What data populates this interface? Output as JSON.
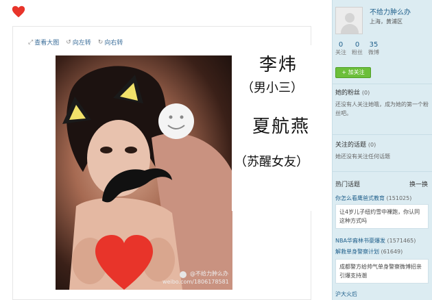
{
  "toolbar": {
    "view_large": "查看大图",
    "rotate_left": "向左转",
    "rotate_right": "向右转"
  },
  "photo": {
    "watermark_user": "@不给力肿么办",
    "watermark_url": "weibo.com/1806178581"
  },
  "caption": {
    "name1": "李炜",
    "role1": "（男小三）",
    "name2": "夏航燕",
    "role2": "（苏醒女友）"
  },
  "profile": {
    "username": "不给力肿么办",
    "location": "上海，黄浦区",
    "stats": [
      {
        "num": "0",
        "label": "关注"
      },
      {
        "num": "0",
        "label": "粉丝"
      },
      {
        "num": "35",
        "label": "微博"
      }
    ],
    "follow_button": "+ 加关注"
  },
  "fans": {
    "title": "她的粉丝",
    "count": "(0)",
    "text": "还没有人关注她哦，成为她的第一个粉丝吧。"
  },
  "topics_followed": {
    "title": "关注的话题",
    "count": "(0)",
    "text": "她还没有关注任何话题"
  },
  "hot_topics": {
    "title": "热门话题",
    "refresh": "换一换",
    "items": [
      {
        "label": "你怎么看鹰爸式教育",
        "count": "(151025)",
        "card": "让4岁儿子纽约雪中裸跑，你认同这种方式吗"
      },
      {
        "label": "NBA华裔林书豪爆发",
        "count": "(1571465)",
        "card": ""
      },
      {
        "label": "解救单身警察计划",
        "count": "(61649)",
        "card": "成都警方给帅气单身警察微博招亲引爆支持潮"
      },
      {
        "label": "沪大火后",
        "count": "",
        "card": ""
      }
    ]
  },
  "colors": {
    "sidebar_bg": "#dcecf2",
    "link": "#1f5f8b",
    "follow_btn": "#6cbf3a",
    "heart": "#e8342a"
  }
}
